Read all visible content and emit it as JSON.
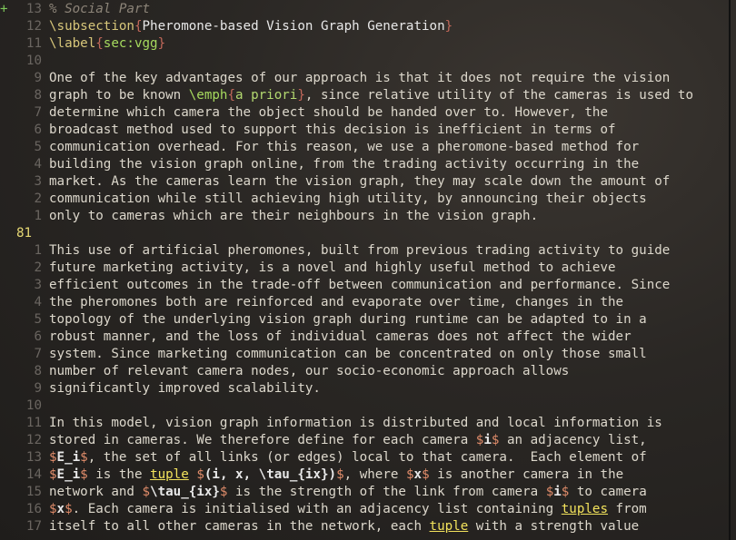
{
  "editor": {
    "sign": "+",
    "current_line": "81",
    "lines": [
      {
        "num": "13",
        "segments": [
          {
            "t": "% Social Part",
            "c": "cmt"
          }
        ]
      },
      {
        "num": "12",
        "segments": [
          {
            "t": "\\subsection",
            "c": "cmd"
          },
          {
            "t": "{",
            "c": "brace"
          },
          {
            "t": "Pheromone-based Vision Graph Generation",
            "c": "arg"
          },
          {
            "t": "}",
            "c": "brace"
          }
        ]
      },
      {
        "num": "11",
        "segments": [
          {
            "t": "\\label",
            "c": "cmd"
          },
          {
            "t": "{",
            "c": "brace"
          },
          {
            "t": "sec:vgg",
            "c": "lbl"
          },
          {
            "t": "}",
            "c": "brace"
          }
        ]
      },
      {
        "num": "10",
        "segments": []
      },
      {
        "num": "9",
        "segments": [
          {
            "t": "One of the key advantages of our approach is that it does not require the vision"
          }
        ]
      },
      {
        "num": "8",
        "segments": [
          {
            "t": "graph to be known "
          },
          {
            "t": "\\emph",
            "c": "lbl"
          },
          {
            "t": "{",
            "c": "brace"
          },
          {
            "t": "a priori",
            "c": "emph"
          },
          {
            "t": "}",
            "c": "brace"
          },
          {
            "t": ", since relative utility of the cameras is used to"
          }
        ]
      },
      {
        "num": "7",
        "segments": [
          {
            "t": "determine which camera the object should be handed over to. However, the"
          }
        ]
      },
      {
        "num": "6",
        "segments": [
          {
            "t": "broadcast method used to support this decision is inefficient in terms of"
          }
        ]
      },
      {
        "num": "5",
        "segments": [
          {
            "t": "communication overhead. For this reason, we use a pheromone-based method for"
          }
        ]
      },
      {
        "num": "4",
        "segments": [
          {
            "t": "building the vision graph online, from the trading activity occurring in the"
          }
        ]
      },
      {
        "num": "3",
        "segments": [
          {
            "t": "market. As the cameras learn the vision graph, they may scale down the amount of"
          }
        ]
      },
      {
        "num": "2",
        "segments": [
          {
            "t": "communication while still achieving high utility, by announcing their objects"
          }
        ]
      },
      {
        "num": "1",
        "segments": [
          {
            "t": "only to cameras which are their neighbours in the vision graph."
          }
        ]
      },
      {
        "num": "81",
        "current": true,
        "segments": []
      },
      {
        "num": "1",
        "segments": [
          {
            "t": "This use of artificial pheromones, built from previous trading activity to guide"
          }
        ]
      },
      {
        "num": "2",
        "segments": [
          {
            "t": "future marketing activity, is a novel and highly useful method to achieve"
          }
        ]
      },
      {
        "num": "3",
        "segments": [
          {
            "t": "efficient outcomes in the trade-off between communication and performance. Since"
          }
        ]
      },
      {
        "num": "4",
        "segments": [
          {
            "t": "the pheromones both are reinforced and evaporate over time, changes in the"
          }
        ]
      },
      {
        "num": "5",
        "segments": [
          {
            "t": "topology of the underlying vision graph during runtime can be adapted to in a"
          }
        ]
      },
      {
        "num": "6",
        "segments": [
          {
            "t": "robust manner, and the loss of individual cameras does not affect the wider"
          }
        ]
      },
      {
        "num": "7",
        "segments": [
          {
            "t": "system. Since marketing communication can be concentrated on only those small"
          }
        ]
      },
      {
        "num": "8",
        "segments": [
          {
            "t": "number of relevant camera nodes, our socio-economic approach allows"
          }
        ]
      },
      {
        "num": "9",
        "segments": [
          {
            "t": "significantly improved scalability."
          }
        ]
      },
      {
        "num": "10",
        "segments": []
      },
      {
        "num": "11",
        "segments": [
          {
            "t": "In this model, vision graph information is distributed and local information is"
          }
        ]
      },
      {
        "num": "12",
        "segments": [
          {
            "t": "stored in cameras. We therefore define for each camera "
          },
          {
            "t": "$",
            "c": "math"
          },
          {
            "t": "i",
            "c": "mathtxt bold"
          },
          {
            "t": "$",
            "c": "math"
          },
          {
            "t": " an adjacency list,"
          }
        ]
      },
      {
        "num": "13",
        "segments": [
          {
            "t": "$",
            "c": "math"
          },
          {
            "t": "E_i",
            "c": "mathtxt bold"
          },
          {
            "t": "$",
            "c": "math"
          },
          {
            "t": ", the set of all links (or edges) local to that camera.  Each element of"
          }
        ]
      },
      {
        "num": "14",
        "segments": [
          {
            "t": "$",
            "c": "math"
          },
          {
            "t": "E_i",
            "c": "mathtxt bold"
          },
          {
            "t": "$",
            "c": "math"
          },
          {
            "t": " is the "
          },
          {
            "t": "tuple",
            "c": "ul"
          },
          {
            "t": " "
          },
          {
            "t": "$",
            "c": "math"
          },
          {
            "t": "(i, x, \\tau_{ix})",
            "c": "mathtxt bold"
          },
          {
            "t": "$",
            "c": "math"
          },
          {
            "t": ", where "
          },
          {
            "t": "$",
            "c": "math"
          },
          {
            "t": "x",
            "c": "mathtxt bold"
          },
          {
            "t": "$",
            "c": "math"
          },
          {
            "t": " is another camera in the"
          }
        ]
      },
      {
        "num": "15",
        "segments": [
          {
            "t": "network and "
          },
          {
            "t": "$",
            "c": "math"
          },
          {
            "t": "\\tau_{ix}",
            "c": "mathtxt bold"
          },
          {
            "t": "$",
            "c": "math"
          },
          {
            "t": " is the strength of the link from camera "
          },
          {
            "t": "$",
            "c": "math"
          },
          {
            "t": "i",
            "c": "mathtxt bold"
          },
          {
            "t": "$",
            "c": "math"
          },
          {
            "t": " to camera"
          }
        ]
      },
      {
        "num": "16",
        "segments": [
          {
            "t": "$",
            "c": "math"
          },
          {
            "t": "x",
            "c": "mathtxt bold"
          },
          {
            "t": "$",
            "c": "math"
          },
          {
            "t": ". Each camera is initialised with an adjacency list containing "
          },
          {
            "t": "tuples",
            "c": "ul"
          },
          {
            "t": " from"
          }
        ]
      },
      {
        "num": "17",
        "segments": [
          {
            "t": "itself to all other cameras in the network, each "
          },
          {
            "t": "tuple",
            "c": "ul"
          },
          {
            "t": " with a strength value"
          }
        ]
      }
    ]
  }
}
